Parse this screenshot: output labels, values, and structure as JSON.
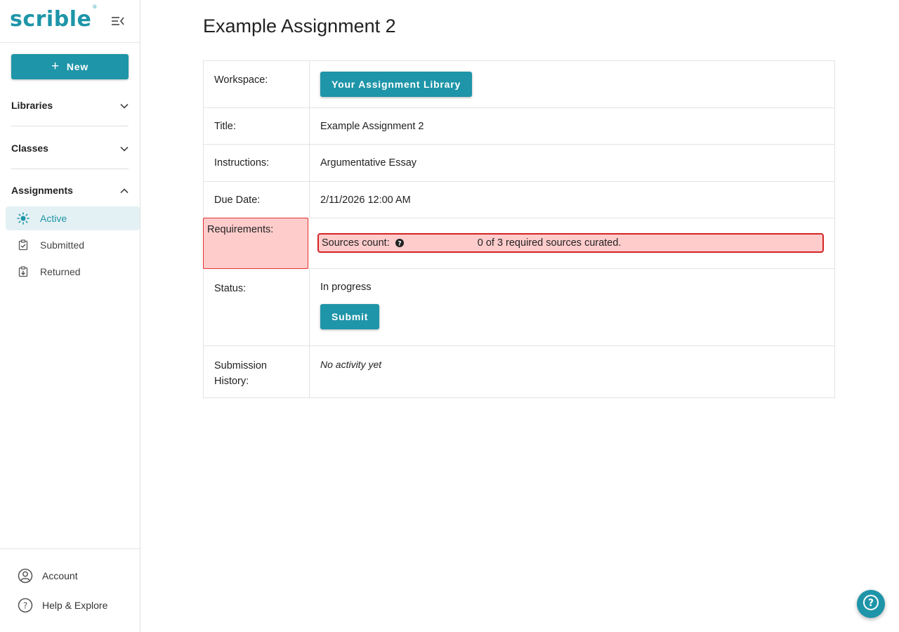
{
  "sidebar": {
    "logo": "scrible",
    "logo_mark": "®",
    "new_button": "New",
    "sections": [
      {
        "label": "Libraries",
        "expanded": false
      },
      {
        "label": "Classes",
        "expanded": false
      },
      {
        "label": "Assignments",
        "expanded": true
      }
    ],
    "assignment_items": [
      {
        "label": "Active",
        "icon": "sun-icon",
        "active": true
      },
      {
        "label": "Submitted",
        "icon": "clipboard-check-icon",
        "active": false
      },
      {
        "label": "Returned",
        "icon": "clipboard-return-icon",
        "active": false
      }
    ],
    "bottom": {
      "account": "Account",
      "help": "Help & Explore"
    }
  },
  "main": {
    "title": "Example Assignment 2",
    "rows": {
      "workspace": {
        "label": "Workspace:",
        "button": "Your Assignment Library"
      },
      "title": {
        "label": "Title:",
        "value": "Example Assignment 2"
      },
      "instructions": {
        "label": "Instructions:",
        "value": "Argumentative Essay"
      },
      "due_date": {
        "label": "Due Date:",
        "value": "2/11/2026 12:00 AM"
      },
      "requirements": {
        "label": "Requirements:",
        "sources_label": "Sources count:",
        "sources_value": "0 of 3 required sources curated."
      },
      "status": {
        "label": "Status:",
        "value": "In progress",
        "button": "Submit"
      },
      "history": {
        "label": "Submission History:",
        "value": "No activity yet"
      }
    }
  },
  "colors": {
    "accent": "#1e95a8",
    "error_bg": "#ffcccc",
    "error_border": "#d42424",
    "active_bg": "#e4f1f4"
  }
}
